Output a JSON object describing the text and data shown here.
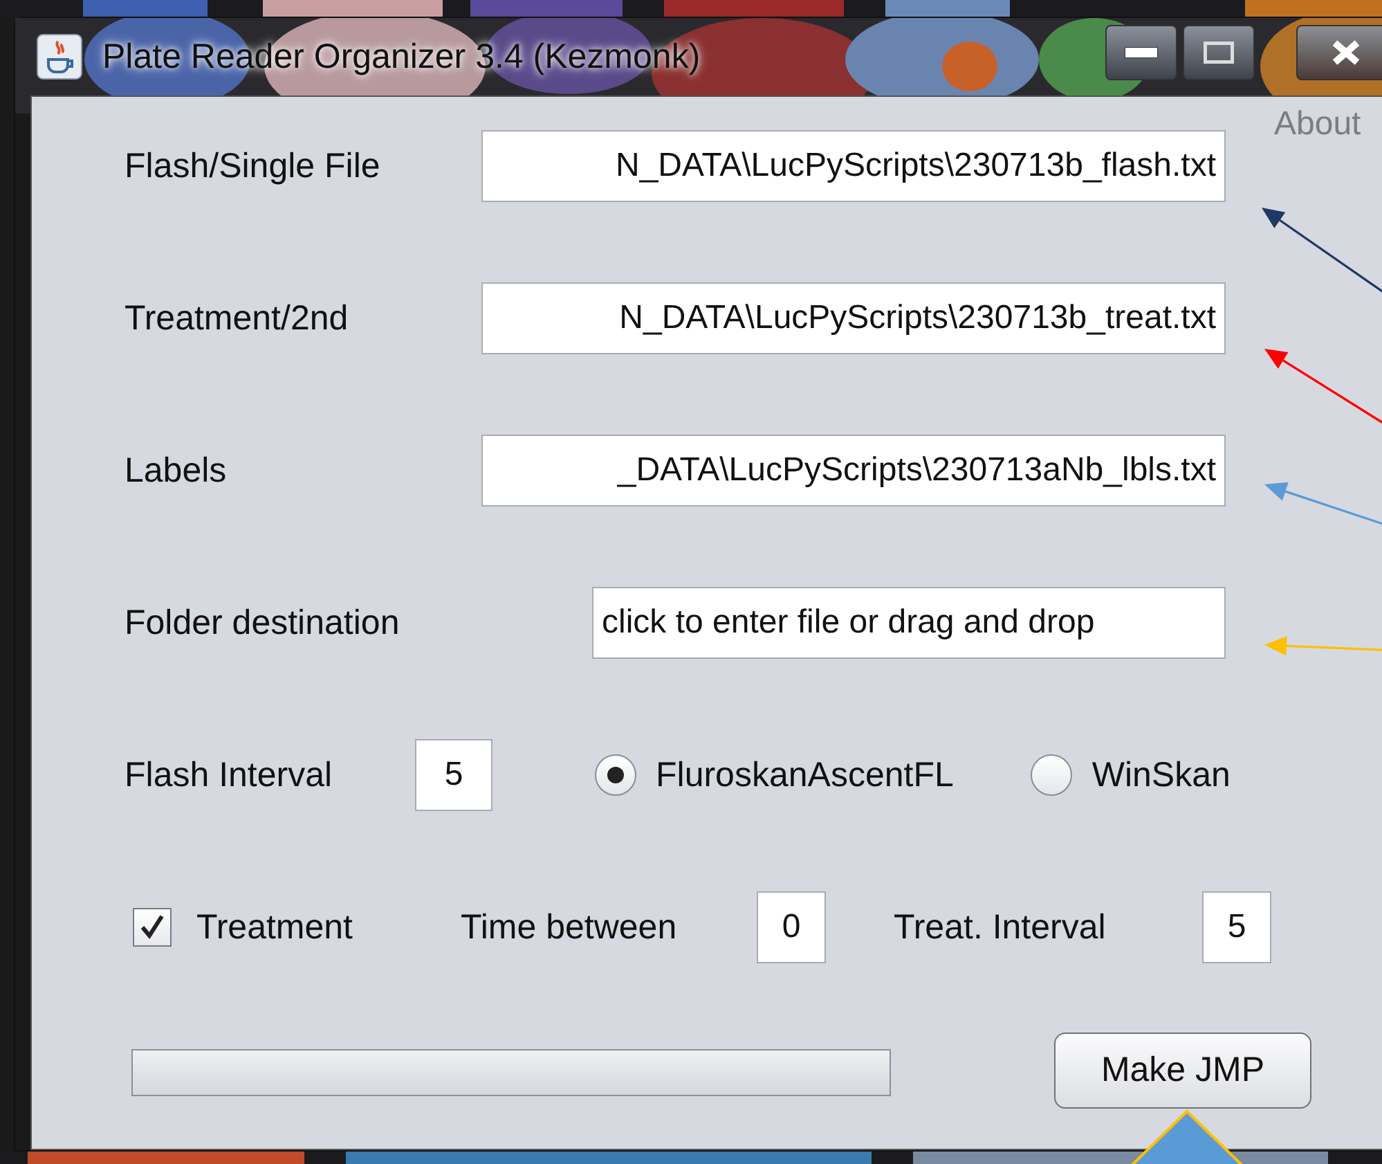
{
  "window": {
    "title": "Plate Reader Organizer 3.4 (Kezmonk)"
  },
  "about_link": "About",
  "file_rows": [
    {
      "label": "Flash/Single File",
      "value": "N_DATA\\LucPyScripts\\230713b_flash.txt"
    },
    {
      "label": "Treatment/2nd",
      "value": "N_DATA\\LucPyScripts\\230713b_treat.txt"
    },
    {
      "label": "Labels",
      "value": "_DATA\\LucPyScripts\\230713aNb_lbls.txt"
    },
    {
      "label": "Folder destination",
      "placeholder": "click to enter file or drag and drop"
    }
  ],
  "flash_interval": {
    "label": "Flash Interval",
    "value": "5"
  },
  "reader_options": [
    {
      "label": "FluroskanAscentFL",
      "selected": true
    },
    {
      "label": "WinSkan",
      "selected": false
    }
  ],
  "treatment": {
    "label": "Treatment",
    "checked": true
  },
  "time_between": {
    "label": "Time between",
    "value": "0"
  },
  "treat_interval": {
    "label": "Treat. Interval",
    "value": "5"
  },
  "progress": {
    "level": 0
  },
  "make_button": "Make JMP",
  "annotations": [
    {
      "kind": "arrow",
      "color": "#1f3864"
    },
    {
      "kind": "arrow",
      "color": "#ff0000"
    },
    {
      "kind": "arrow",
      "color": "#5b9bd5"
    },
    {
      "kind": "arrow",
      "color": "#ffc000"
    },
    {
      "kind": "triangle",
      "color": "#5b9bd5"
    }
  ]
}
